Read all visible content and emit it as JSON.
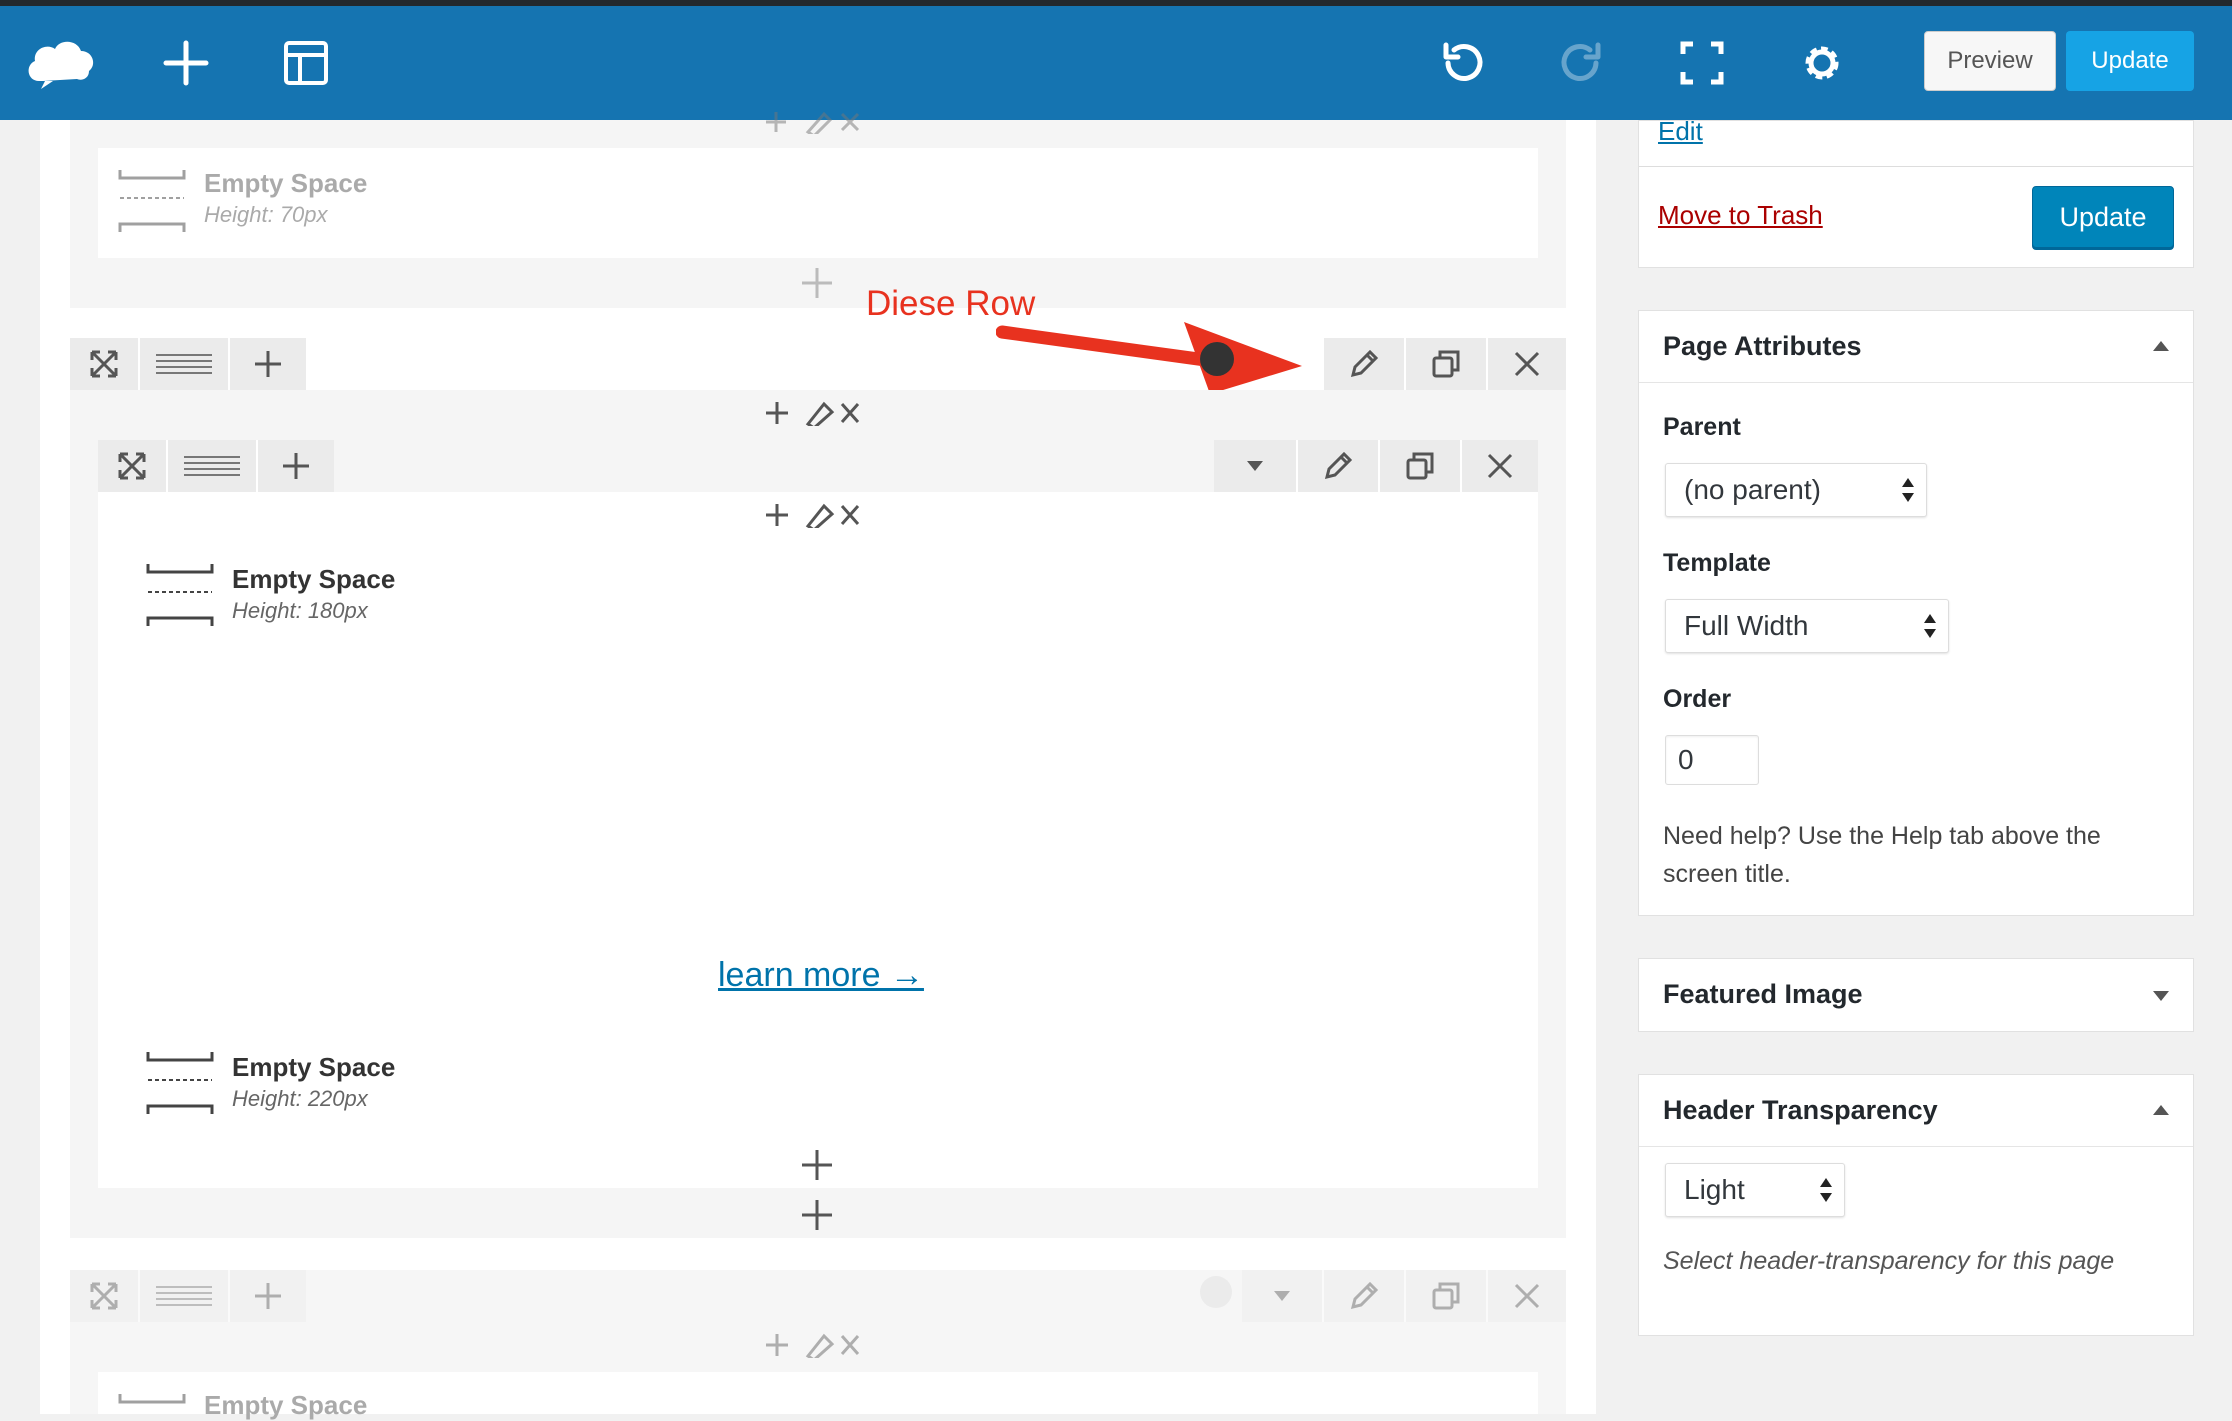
{
  "toolbar": {
    "logo_icon": "cloud-logo-icon",
    "add_icon": "plus-icon",
    "templates_icon": "layout-icon",
    "undo_icon": "undo-icon",
    "redo_icon": "redo-icon",
    "fullscreen_icon": "fullscreen-icon",
    "settings_icon": "gear-icon",
    "preview_label": "Preview",
    "update_label": "Update",
    "accent_color": "#1574b1",
    "update_color": "#16a3e5"
  },
  "builder": {
    "row1": {
      "element_title": "Empty Space",
      "element_sub": "Height: 70px"
    },
    "annotation": {
      "label": "Diese Row",
      "color": "#e8321f"
    },
    "row2": {
      "elements": [
        {
          "title": "Empty Space",
          "sub": "Height: 180px"
        },
        {
          "title": "Empty Space",
          "sub": "Height: 220px"
        }
      ],
      "link_text": "learn more →"
    },
    "row3": {
      "element_title": "Empty Space"
    }
  },
  "sidebar": {
    "publish": {
      "edit_link": "Edit",
      "trash_link": "Move to Trash",
      "update_label": "Update"
    },
    "page_attributes": {
      "title": "Page Attributes",
      "parent_label": "Parent",
      "parent_value": "(no parent)",
      "template_label": "Template",
      "template_value": "Full Width",
      "order_label": "Order",
      "order_value": "0",
      "help_text": "Need help? Use the Help tab above the screen title."
    },
    "featured_image": {
      "title": "Featured Image"
    },
    "header_transparency": {
      "title": "Header Transparency",
      "value": "Light",
      "help_text": "Select header-transparency for this page"
    }
  }
}
